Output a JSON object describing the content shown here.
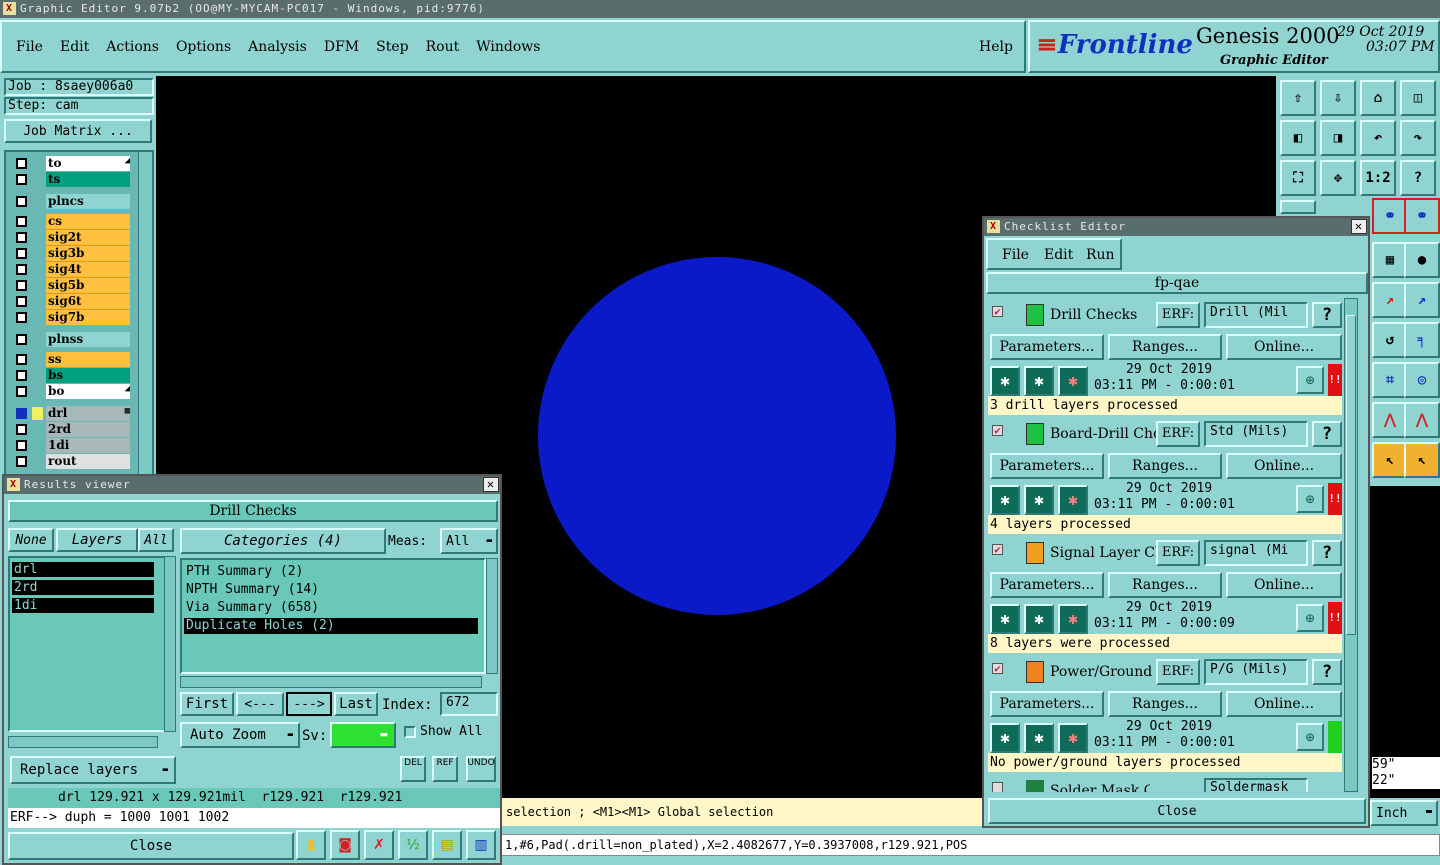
{
  "window": {
    "title": "Graphic Editor 9.07b2 (OO@MY-MYCAM-PC017 - Windows, pid:9776)"
  },
  "menu": [
    "File",
    "Edit",
    "Actions",
    "Options",
    "Analysis",
    "DFM",
    "Step",
    "Rout",
    "Windows"
  ],
  "help_label": "Help",
  "brand": {
    "logo": "Frontline",
    "product": "Genesis 2000",
    "subtitle": "Graphic Editor",
    "date": "29 Oct 2019",
    "time": "03:07 PM"
  },
  "job": {
    "job": "Job : 8saey006a0",
    "step": "Step: cam",
    "matrix_button": "Job Matrix ..."
  },
  "layers": [
    {
      "name": "to",
      "color": "#ffffff",
      "mark": "◢"
    },
    {
      "name": "ts",
      "color": "#00a080",
      "mark": ""
    },
    {
      "name": "plncs",
      "color": "#8fd4d0",
      "mark": ""
    },
    {
      "name": "cs",
      "color": "#ffc040",
      "mark": ""
    },
    {
      "name": "sig2t",
      "color": "#ffc040",
      "mark": ""
    },
    {
      "name": "sig3b",
      "color": "#ffc040",
      "mark": ""
    },
    {
      "name": "sig4t",
      "color": "#ffc040",
      "mark": ""
    },
    {
      "name": "sig5b",
      "color": "#ffc040",
      "mark": ""
    },
    {
      "name": "sig6t",
      "color": "#ffc040",
      "mark": ""
    },
    {
      "name": "sig7b",
      "color": "#ffc040",
      "mark": ""
    },
    {
      "name": "plnss",
      "color": "#8fd4d0",
      "mark": ""
    },
    {
      "name": "ss",
      "color": "#ffc040",
      "mark": ""
    },
    {
      "name": "bs",
      "color": "#00a080",
      "mark": ""
    },
    {
      "name": "bo",
      "color": "#ffffff",
      "mark": "◢"
    },
    {
      "name": "drl",
      "color": "#a8b8b8",
      "mark": "▦"
    },
    {
      "name": "2rd",
      "color": "#a8b8b8",
      "mark": ""
    },
    {
      "name": "1di",
      "color": "#a8b8b8",
      "mark": ""
    },
    {
      "name": "rout",
      "color": "#e0e0e0",
      "mark": ""
    }
  ],
  "results_viewer": {
    "title": "Results viewer",
    "header": "Drill Checks",
    "none_label": "None",
    "layers_label": "Layers",
    "all_label": "All",
    "categories_label": "Categories (4)",
    "meas_label": "Meas:",
    "meas_value": "All",
    "layer_list": [
      "drl",
      "2rd",
      "1di"
    ],
    "categories": [
      "PTH Summary (2)",
      "NPTH Summary (14)",
      "Via Summary (658)",
      "Duplicate Holes (2)"
    ],
    "nav": {
      "first": "First",
      "prev": "<---",
      "next": "--->",
      "last": "Last",
      "index_label": "Index:",
      "index_value": "672"
    },
    "auto_zoom": "Auto Zoom",
    "sv_label": "Sv:",
    "show_all": "Show All",
    "replace_layers": "Replace layers",
    "small_buttons": [
      "DEL",
      "REF",
      "UNDO"
    ],
    "info_line": "drl 129.921 x 129.921mil  r129.921  r129.921",
    "erf_line": "ERF--> duph = 1000 1001 1002",
    "close": "Close"
  },
  "checklist": {
    "title": "Checklist Editor",
    "menu": [
      "File",
      "Edit",
      "Run"
    ],
    "name": "fp-qae",
    "items": [
      {
        "name": "Drill Checks",
        "erf": "Drill (Mil",
        "date": "29 Oct 2019",
        "time": "03:11 PM - 0:00:01",
        "msg": "3 drill layers processed",
        "status": "#e01010",
        "flag": "!!",
        "icon_color": "#20c040"
      },
      {
        "name": "Board-Drill Che",
        "erf": "Std (Mils)",
        "date": "29 Oct 2019",
        "time": "03:11 PM - 0:00:01",
        "msg": "4 layers processed",
        "status": "#e01010",
        "flag": "!!",
        "icon_color": "#20c040"
      },
      {
        "name": "Signal Layer Ch",
        "erf": "signal (Mi",
        "date": "29 Oct 2019",
        "time": "03:11 PM - 0:00:09",
        "msg": "8 layers were processed",
        "status": "#e01010",
        "flag": "!!",
        "icon_color": "#f0a020"
      },
      {
        "name": "Power/Ground C",
        "erf": "P/G (Mils)",
        "date": "29 Oct 2019",
        "time": "03:11 PM - 0:00:01",
        "msg": "No power/ground layers processed",
        "status": "#20d020",
        "flag": "",
        "icon_color": "#f08020"
      }
    ],
    "partial_item": {
      "name": "Solder Mask Ch",
      "erf": "Soldermask"
    },
    "erf_label": "ERF:",
    "parameters": "Parameters...",
    "ranges": "Ranges...",
    "online": "Online...",
    "help": "?",
    "close": "Close"
  },
  "status": {
    "hint": "selection ; <M1><M1> Global selection",
    "feature": "1,#6,Pad(.drill=non_plated),X=2.4082677,Y=0.3937008,r129.921,POS",
    "coord1": "59\"",
    "coord2": "22\"",
    "units": "Inch"
  },
  "toolbar_icons": [
    "home-up-icon",
    "home-down-icon",
    "home-icon",
    "panel-icon",
    "prev-icon",
    "next-icon",
    "undo-icon",
    "redo-icon",
    "fit-icon",
    "center-icon",
    "scale-icon",
    "help-icon"
  ],
  "toolbar_labels": [
    "⇧",
    "⇩",
    "⌂",
    "◫",
    "◧",
    "◨",
    "↶",
    "↷",
    "⛶",
    "✥",
    "1:2",
    "?"
  ],
  "colors": {
    "canvas": "#000000",
    "pad": "#0a1ac8",
    "panel": "#8fd4d0",
    "selected": "#000000"
  }
}
